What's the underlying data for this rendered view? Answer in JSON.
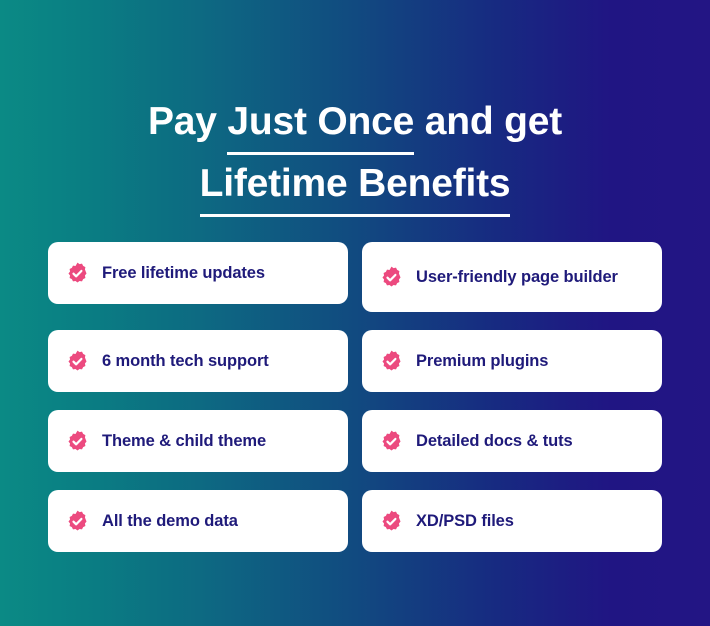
{
  "theme": {
    "bg_gradient_start": "#0b8a85",
    "bg_gradient_mid": "#114a80",
    "bg_gradient_end": "#231584",
    "heading_color": "#ffffff",
    "card_bg": "#ffffff",
    "card_text_color": "#1f1a7a",
    "badge_color": "#ec4a7f",
    "badge_check_color": "#ffffff"
  },
  "headline": {
    "line1_prefix": "Pay ",
    "line1_emphasis": "Just Once",
    "line1_suffix": " and get",
    "line2_emphasis": "Lifetime Benefits"
  },
  "benefits": [
    {
      "label": "Free lifetime updates",
      "icon": "check-badge-icon",
      "column": "left"
    },
    {
      "label": "User-friendly page builder",
      "icon": "check-badge-icon",
      "column": "right"
    },
    {
      "label": "6 month tech support",
      "icon": "check-badge-icon",
      "column": "left"
    },
    {
      "label": "Premium plugins",
      "icon": "check-badge-icon",
      "column": "right"
    },
    {
      "label": "Theme & child theme",
      "icon": "check-badge-icon",
      "column": "left"
    },
    {
      "label": "Detailed docs & tuts",
      "icon": "check-badge-icon",
      "column": "right"
    },
    {
      "label": "All the demo data",
      "icon": "check-badge-icon",
      "column": "left"
    },
    {
      "label": "XD/PSD files",
      "icon": "check-badge-icon",
      "column": "right"
    }
  ]
}
